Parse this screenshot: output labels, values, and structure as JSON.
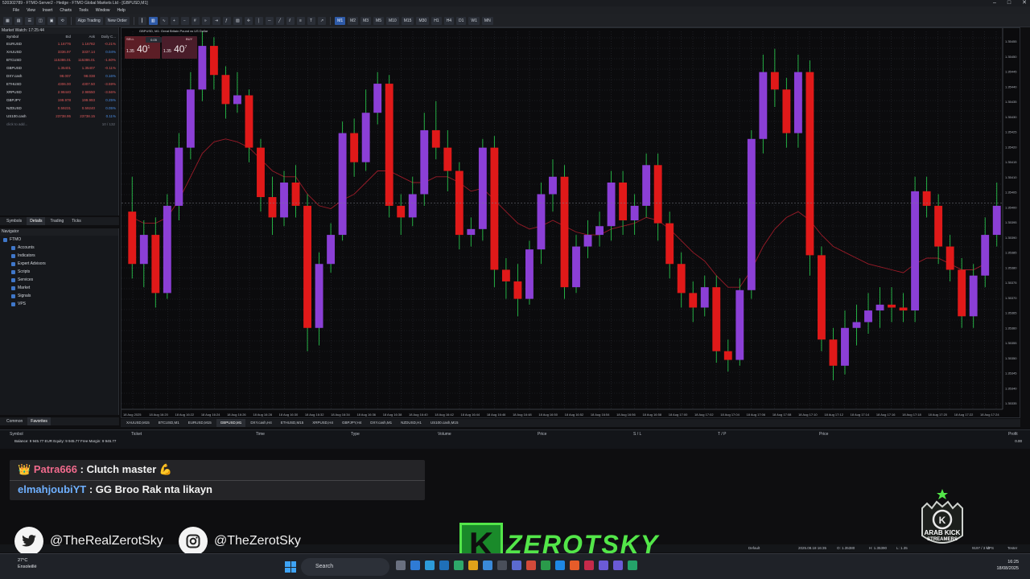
{
  "window": {
    "title": "520302789 - FTMO-Server2 - Hedge - FTMO Global Markets Ltd - [GBPUSD,M1]",
    "controls": [
      "–",
      "□",
      "✕"
    ]
  },
  "menu": [
    "File",
    "View",
    "Insert",
    "Charts",
    "Tools",
    "Window",
    "Help"
  ],
  "toolbar": {
    "algo_trading": "Algo Trading",
    "new_order": "New Order",
    "timeframes": [
      "M1",
      "M2",
      "M3",
      "M5",
      "M10",
      "M15",
      "M30",
      "H1",
      "H4",
      "D1",
      "W1",
      "MN"
    ],
    "active_timeframe": "M1"
  },
  "market_watch": {
    "title": "Market Watch: 17:25:44",
    "headers": {
      "symbol": "Symbol",
      "bid": "Bid",
      "ask": "Ask",
      "change": "Daily C..."
    },
    "rows": [
      {
        "symbol": "EURUSD",
        "bid": "1.16776",
        "ask": "1.16782",
        "change": "-0.21%",
        "dir": "dn"
      },
      {
        "symbol": "XAUUSD",
        "bid": "3336.97",
        "ask": "3337.14",
        "change": "0.04%",
        "dir": "up"
      },
      {
        "symbol": "BTCUSD",
        "bid": "115386.01",
        "ask": "115386.01",
        "change": "-1.60%",
        "dir": "dn"
      },
      {
        "symbol": "GBPUSD",
        "bid": "1.35401",
        "ask": "1.35407",
        "change": "-0.11%",
        "dir": "dn"
      },
      {
        "symbol": "DXY.cash",
        "bid": "98.007",
        "ask": "98.038",
        "change": "0.16%",
        "dir": "up"
      },
      {
        "symbol": "ETHUSD",
        "bid": "4306.00",
        "ask": "4307.50",
        "change": "-3.59%",
        "dir": "dn"
      },
      {
        "symbol": "XRPUSD",
        "bid": "2.98440",
        "ask": "2.98550",
        "change": "-3.56%",
        "dir": "dn"
      },
      {
        "symbol": "GBPJPY",
        "bid": "199.978",
        "ask": "199.993",
        "change": "0.25%",
        "dir": "up"
      },
      {
        "symbol": "NZDUSD",
        "bid": "0.59231",
        "ask": "0.59240",
        "change": "0.05%",
        "dir": "up"
      },
      {
        "symbol": "US100.cash",
        "bid": "23738.95",
        "ask": "23738.15",
        "change": "0.11%",
        "dir": "up"
      }
    ],
    "add_hint": "click to add...",
    "count": "10 / 132",
    "tabs": [
      "Symbols",
      "Details",
      "Trading",
      "Ticks"
    ],
    "selected_tab": "Details"
  },
  "navigator": {
    "title": "Navigator",
    "root": "FTMO",
    "items": [
      "Accounts",
      "Indicators",
      "Expert Advisors",
      "Scripts",
      "Services",
      "Market",
      "Signals",
      "VPS"
    ],
    "bottom_tabs": [
      "Common",
      "Favorites"
    ],
    "bottom_selected": "Favorites"
  },
  "chart": {
    "header": "GBPUSD, M1:  Great Britain Pound vs US Dollar",
    "sell_label": "SELL",
    "buy_label": "BUY",
    "lot": "0.05",
    "sell_price_prefix": "1.35",
    "sell_price_big": "40",
    "sell_price_sup": "1",
    "buy_price_prefix": "1.35",
    "buy_price_big": "40",
    "buy_price_sup": "7",
    "price_labels": [
      "1.35455",
      "1.35450",
      "1.35445",
      "1.35440",
      "1.35435",
      "1.35430",
      "1.35425",
      "1.35420",
      "1.35415",
      "1.35410",
      "1.35405",
      "1.35400",
      "1.35395",
      "1.35390",
      "1.35385",
      "1.35380",
      "1.35375",
      "1.35370",
      "1.35365",
      "1.35360",
      "1.35355",
      "1.35350",
      "1.35345",
      "1.35340",
      "1.35335"
    ],
    "time_labels": [
      "18 Aug 2025",
      "18 Aug 16:20",
      "18 Aug 16:22",
      "18 Aug 16:24",
      "18 Aug 16:26",
      "18 Aug 16:28",
      "18 Aug 16:30",
      "18 Aug 16:32",
      "18 Aug 16:34",
      "18 Aug 16:36",
      "18 Aug 16:38",
      "18 Aug 16:40",
      "18 Aug 16:42",
      "18 Aug 16:44",
      "18 Aug 16:46",
      "18 Aug 16:48",
      "18 Aug 16:50",
      "18 Aug 16:52",
      "18 Aug 16:54",
      "18 Aug 16:56",
      "18 Aug 16:58",
      "18 Aug 17:00",
      "18 Aug 17:02",
      "18 Aug 17:04",
      "18 Aug 17:06",
      "18 Aug 17:08",
      "18 Aug 17:10",
      "18 Aug 17:12",
      "18 Aug 17:14",
      "18 Aug 17:16",
      "18 Aug 17:18",
      "18 Aug 17:20",
      "18 Aug 17:22",
      "18 Aug 17:24"
    ],
    "bull_color": "#8b3fd6",
    "bear_color": "#e01919",
    "wick_color": "#27c24a",
    "ma_color": "#9b1b28",
    "candles": [
      [
        1.35398,
        1.3538,
        1.3541,
        1.35375
      ],
      [
        1.3538,
        1.3539,
        1.35395,
        1.35372
      ],
      [
        1.3539,
        1.3537,
        1.35396,
        1.35365
      ],
      [
        1.3537,
        1.354,
        1.35404,
        1.35368
      ],
      [
        1.354,
        1.3542,
        1.35425,
        1.35395
      ],
      [
        1.3542,
        1.3544,
        1.35446,
        1.35416
      ],
      [
        1.3544,
        1.35455,
        1.3546,
        1.35436
      ],
      [
        1.35455,
        1.35445,
        1.35458,
        1.3544
      ],
      [
        1.35445,
        1.35435,
        1.35448,
        1.3543
      ],
      [
        1.35435,
        1.35438,
        1.35446,
        1.35432
      ],
      [
        1.35438,
        1.3542,
        1.3544,
        1.35415
      ],
      [
        1.3542,
        1.35403,
        1.35423,
        1.35398
      ],
      [
        1.35403,
        1.35396,
        1.3541,
        1.3539
      ],
      [
        1.35396,
        1.35408,
        1.35412,
        1.35393
      ],
      [
        1.35408,
        1.354,
        1.35414,
        1.35396
      ],
      [
        1.354,
        1.35358,
        1.35404,
        1.3535
      ],
      [
        1.35358,
        1.3538,
        1.35384,
        1.35352
      ],
      [
        1.3538,
        1.3539,
        1.35394,
        1.35377
      ],
      [
        1.3539,
        1.35425,
        1.35429,
        1.35388
      ],
      [
        1.35425,
        1.35415,
        1.3543,
        1.3541
      ],
      [
        1.35415,
        1.35432,
        1.3544,
        1.35412
      ],
      [
        1.35432,
        1.35442,
        1.35446,
        1.35428
      ],
      [
        1.35442,
        1.354,
        1.35445,
        1.35396
      ],
      [
        1.354,
        1.35396,
        1.35404,
        1.3539
      ],
      [
        1.35396,
        1.35404,
        1.3541,
        1.35393
      ],
      [
        1.35404,
        1.35426,
        1.35432,
        1.354
      ],
      [
        1.35426,
        1.3542,
        1.35436,
        1.35416
      ],
      [
        1.3542,
        1.35412,
        1.35426,
        1.35405
      ],
      [
        1.35412,
        1.3539,
        1.35415,
        1.35385
      ],
      [
        1.3539,
        1.35392,
        1.35396,
        1.35386
      ],
      [
        1.35392,
        1.3542,
        1.35423,
        1.35388
      ],
      [
        1.3542,
        1.35378,
        1.35424,
        1.35372
      ],
      [
        1.35378,
        1.35374,
        1.35382,
        1.35368
      ],
      [
        1.35374,
        1.35368,
        1.3538,
        1.35362
      ],
      [
        1.35368,
        1.35385,
        1.35388,
        1.35366
      ],
      [
        1.35385,
        1.35404,
        1.35408,
        1.3538
      ],
      [
        1.35404,
        1.3541,
        1.35416,
        1.35398
      ],
      [
        1.3541,
        1.35372,
        1.35414,
        1.35368
      ],
      [
        1.35372,
        1.35386,
        1.3539,
        1.3537
      ],
      [
        1.35386,
        1.3539,
        1.35395,
        1.35382
      ],
      [
        1.3539,
        1.35393,
        1.35398,
        1.35386
      ],
      [
        1.35393,
        1.35408,
        1.35412,
        1.35388
      ],
      [
        1.35408,
        1.35395,
        1.35412,
        1.3539
      ],
      [
        1.35395,
        1.354,
        1.35404,
        1.3539
      ],
      [
        1.354,
        1.35414,
        1.35418,
        1.35396
      ],
      [
        1.35414,
        1.35394,
        1.35418,
        1.35388
      ],
      [
        1.35394,
        1.3538,
        1.35398,
        1.35375
      ],
      [
        1.3538,
        1.3537,
        1.35384,
        1.35365
      ],
      [
        1.3537,
        1.35365,
        1.35374,
        1.3536
      ],
      [
        1.35365,
        1.35372,
        1.35376,
        1.35362
      ],
      [
        1.35372,
        1.3535,
        1.35376,
        1.35346
      ],
      [
        1.3535,
        1.35347,
        1.35354,
        1.35343
      ],
      [
        1.35347,
        1.35371,
        1.35375,
        1.35345
      ],
      [
        1.35371,
        1.35423,
        1.35426,
        1.35368
      ],
      [
        1.35423,
        1.35446,
        1.35452,
        1.35418
      ],
      [
        1.35446,
        1.3544,
        1.35454,
        1.35434
      ],
      [
        1.3544,
        1.35425,
        1.35444,
        1.3542
      ],
      [
        1.35425,
        1.35446,
        1.35452,
        1.3542
      ],
      [
        1.35446,
        1.35383,
        1.3545,
        1.35376
      ],
      [
        1.35383,
        1.35354,
        1.35386,
        1.3535
      ],
      [
        1.35354,
        1.35345,
        1.35358,
        1.3534
      ],
      [
        1.35345,
        1.35358,
        1.35364,
        1.35342
      ],
      [
        1.35358,
        1.3536,
        1.35366,
        1.35352
      ],
      [
        1.3536,
        1.35364,
        1.3537,
        1.35356
      ],
      [
        1.35364,
        1.35366,
        1.35372,
        1.35358
      ],
      [
        1.35366,
        1.35365,
        1.35372,
        1.3536
      ],
      [
        1.35365,
        1.35364,
        1.3537,
        1.3536
      ],
      [
        1.35364,
        1.35405,
        1.3541,
        1.3536
      ],
      [
        1.35405,
        1.354,
        1.3541,
        1.35396
      ],
      [
        1.354,
        1.35386,
        1.35404,
        1.3538
      ],
      [
        1.35386,
        1.35378,
        1.3539,
        1.35374
      ],
      [
        1.35378,
        1.35362,
        1.35382,
        1.35358
      ],
      [
        1.35362,
        1.35376,
        1.3538,
        1.35358
      ],
      [
        1.35376,
        1.3539,
        1.35396,
        1.35372
      ],
      [
        1.3539,
        1.354,
        1.35408,
        1.35386
      ]
    ],
    "ma": [
      1.35396,
      1.35394,
      1.35394,
      1.35396,
      1.35402,
      1.3541,
      1.35418,
      1.35422,
      1.35423,
      1.35422,
      1.3542,
      1.35416,
      1.35412,
      1.3541,
      1.3541,
      1.35404,
      1.354,
      1.35399,
      1.35402,
      1.35404,
      1.35408,
      1.35412,
      1.35412,
      1.3541,
      1.35408,
      1.35408,
      1.3541,
      1.3541,
      1.35408,
      1.35405,
      1.35406,
      1.35402,
      1.35398,
      1.35394,
      1.35392,
      1.35393,
      1.35395,
      1.35393,
      1.35391,
      1.3539,
      1.3539,
      1.35392,
      1.35393,
      1.35394,
      1.35396,
      1.35395,
      1.35392,
      1.35388,
      1.35384,
      1.35381,
      1.35376,
      1.35372,
      1.35372,
      1.35378,
      1.35386,
      1.35392,
      1.35396,
      1.35398,
      1.35395,
      1.3539,
      1.35386,
      1.35384,
      1.35382,
      1.3538,
      1.35379,
      1.35378,
      1.35377,
      1.3538,
      1.35382,
      1.35382,
      1.3538,
      1.35378,
      1.35378,
      1.3538
    ]
  },
  "symbol_tabs": [
    "XAUUSD,M15",
    "BTCUSD,M1",
    "EURUSD,M15",
    "GBPUSD,M1",
    "DXY.cash,H4",
    "ETHUSD,M15",
    "XRPUSD,H4",
    "GBPJPY,H4",
    "DXY.cash,M1",
    "NZDUSD,H1",
    "US100.cash,M15"
  ],
  "symbol_tab_selected": "GBPUSD,M1",
  "toolbox": {
    "headers": [
      "Symbol",
      "Ticket",
      "Time",
      "Type",
      "Volume",
      "Price",
      "S / L",
      "T / P",
      "Price",
      "Profit"
    ],
    "balance": "Balance: 9 945.77 EUR  Equity: 9 945.77  Free Margin: 9 945.77",
    "profit_total": "0.00"
  },
  "chat": [
    {
      "user": "Patra666",
      "msg": ": Clutch master 💪",
      "icon": "👑"
    },
    {
      "user": "elmahjoubiYT",
      "msg": ": GG Broo Rak nta likayn"
    }
  ],
  "socials": [
    {
      "icon": "twitter-icon",
      "handle": "@TheRealZerotSky"
    },
    {
      "icon": "instagram-icon",
      "handle": "@TheZerotSky"
    }
  ],
  "brand": {
    "letter": "K",
    "name": "ZEROTSKY"
  },
  "badge": {
    "line1": "ARAB KICK",
    "line2": "STREAMERS"
  },
  "statusbar": {
    "profile": "Default",
    "datetime": "2025.08.18 16:35",
    "open": "O: 1.35380",
    "high": "H: 1.35390",
    "low": "L: 1.35",
    "vps": "VPS",
    "tester": "Tester",
    "traffic": "9197 / 3 kb"
  },
  "taskbar": {
    "temp": "27°C",
    "weather": "Ensoleillé",
    "search": "Search",
    "time": "16:25",
    "date": "18/08/2025"
  }
}
